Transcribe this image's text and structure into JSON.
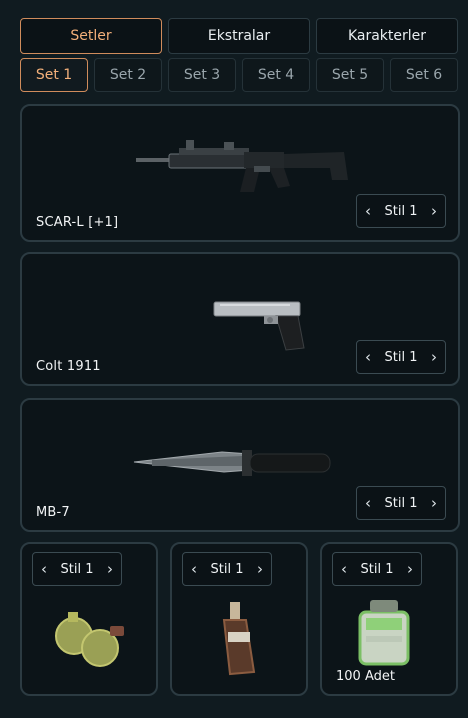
{
  "tabs": {
    "main": [
      {
        "label": "Setler"
      },
      {
        "label": "Ekstralar"
      },
      {
        "label": "Karakterler"
      }
    ],
    "sets": [
      {
        "label": "Set 1"
      },
      {
        "label": "Set 2"
      },
      {
        "label": "Set 3"
      },
      {
        "label": "Set 4"
      },
      {
        "label": "Set 5"
      },
      {
        "label": "Set 6"
      }
    ]
  },
  "loadout": {
    "primary": {
      "name": "SCAR-L [+1]",
      "style": "Stil 1"
    },
    "secondary": {
      "name": "Colt 1911",
      "style": "Stil 1"
    },
    "melee": {
      "name": "MB-7",
      "style": "Stil 1"
    },
    "throwables": [
      {
        "style": "Stil 1"
      },
      {
        "style": "Stil 1"
      },
      {
        "style": "Stil 1",
        "count": "100 Adet"
      }
    ]
  },
  "icons": {
    "left": "chevron-left-icon",
    "right": "chevron-right-icon"
  }
}
